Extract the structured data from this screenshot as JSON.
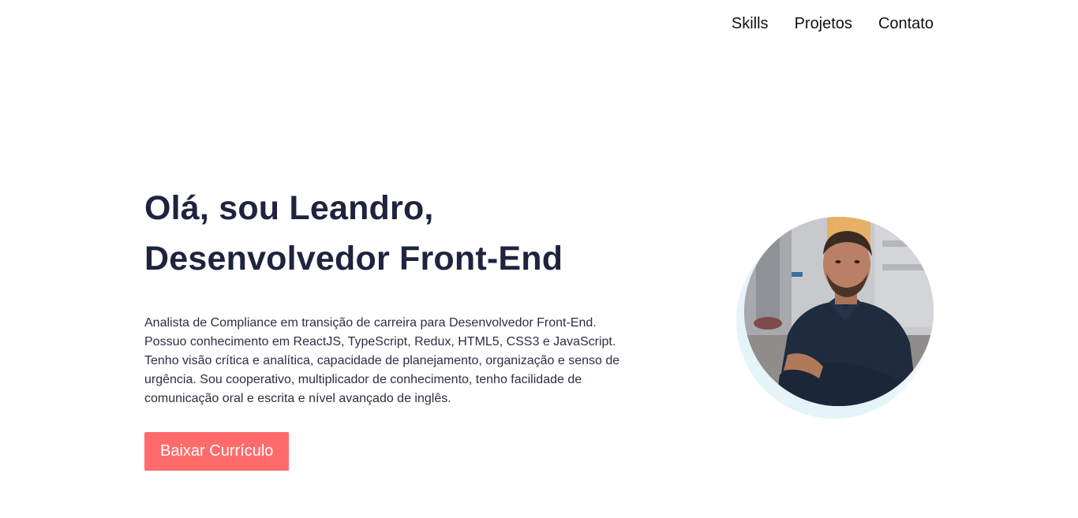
{
  "nav": {
    "items": [
      {
        "label": "Skills"
      },
      {
        "label": "Projetos"
      },
      {
        "label": "Contato"
      }
    ]
  },
  "hero": {
    "title_line1": "Olá, sou Leandro,",
    "title_line2": "Desenvolvedor Front-End",
    "description": "Analista de Compliance em transição de carreira para Desenvolvedor Front-End. Possuo conhecimento em ReactJS, TypeScript, Redux, HTML5, CSS3 e JavaScript. Tenho visão crítica e analítica, capacidade de planejamento, organização e senso de urgência. Sou cooperativo, multiplicador de conhecimento, tenho facilidade de comunicação oral e escrita e nível avançado de inglês.",
    "button_label": "Baixar Currículo"
  },
  "colors": {
    "heading": "#1e2340",
    "button": "#ff6b6b",
    "glow": "#e4f4f8"
  },
  "icons": {
    "profile_photo": "profile-photo"
  }
}
